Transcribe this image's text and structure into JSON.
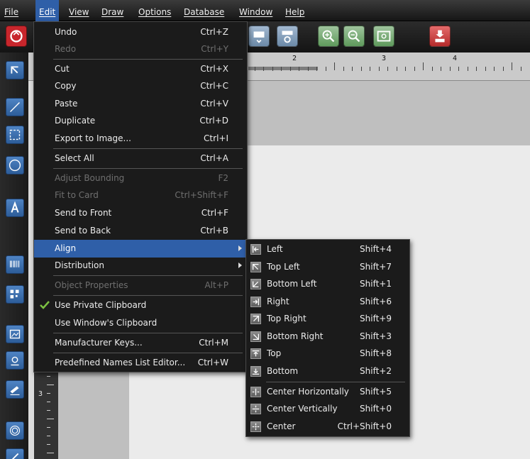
{
  "menubar": {
    "items": [
      {
        "label": "File"
      },
      {
        "label": "Edit"
      },
      {
        "label": "View"
      },
      {
        "label": "Draw"
      },
      {
        "label": "Options"
      },
      {
        "label": "Database"
      },
      {
        "label": "Window"
      },
      {
        "label": "Help"
      }
    ]
  },
  "ruler": {
    "labels": [
      "2",
      "3",
      "4"
    ]
  },
  "vruler": {
    "label": "3"
  },
  "edit_menu": {
    "items": [
      {
        "label": "Undo",
        "shortcut": "Ctrl+Z"
      },
      {
        "label": "Redo",
        "shortcut": "Ctrl+Y"
      },
      {
        "label": "Cut",
        "shortcut": "Ctrl+X"
      },
      {
        "label": "Copy",
        "shortcut": "Ctrl+C"
      },
      {
        "label": "Paste",
        "shortcut": "Ctrl+V"
      },
      {
        "label": "Duplicate",
        "shortcut": "Ctrl+D"
      },
      {
        "label": "Export to Image...",
        "shortcut": "Ctrl+I"
      },
      {
        "label": "Select All",
        "shortcut": "Ctrl+A"
      },
      {
        "label": "Adjust Bounding",
        "shortcut": "F2"
      },
      {
        "label": "Fit to Card",
        "shortcut": "Ctrl+Shift+F"
      },
      {
        "label": "Send to Front",
        "shortcut": "Ctrl+F"
      },
      {
        "label": "Send to Back",
        "shortcut": "Ctrl+B"
      },
      {
        "label": "Align",
        "shortcut": ""
      },
      {
        "label": "Distribution",
        "shortcut": ""
      },
      {
        "label": "Object Properties",
        "shortcut": "Alt+P"
      },
      {
        "label": "Use Private Clipboard",
        "shortcut": ""
      },
      {
        "label": "Use Window's Clipboard",
        "shortcut": ""
      },
      {
        "label": "Manufacturer Keys...",
        "shortcut": "Ctrl+M"
      },
      {
        "label": "Predefined Names List Editor...",
        "shortcut": "Ctrl+W"
      }
    ]
  },
  "align_submenu": {
    "items": [
      {
        "label": "Left",
        "shortcut": "Shift+4"
      },
      {
        "label": "Top Left",
        "shortcut": "Shift+7"
      },
      {
        "label": "Bottom Left",
        "shortcut": "Shift+1"
      },
      {
        "label": "Right",
        "shortcut": "Shift+6"
      },
      {
        "label": "Top Right",
        "shortcut": "Shift+9"
      },
      {
        "label": "Bottom Right",
        "shortcut": "Shift+3"
      },
      {
        "label": "Top",
        "shortcut": "Shift+8"
      },
      {
        "label": "Bottom",
        "shortcut": "Shift+2"
      },
      {
        "label": "Center Horizontally",
        "shortcut": "Shift+5"
      },
      {
        "label": "Center Vertically",
        "shortcut": "Shift+0"
      },
      {
        "label": "Center",
        "shortcut": "Ctrl+Shift+0"
      }
    ]
  },
  "colors": {
    "highlight": "#2f5fa8",
    "menu_bg": "#1b1b1b",
    "disabled_text": "#6f6f6f",
    "check": "#7cc142"
  }
}
